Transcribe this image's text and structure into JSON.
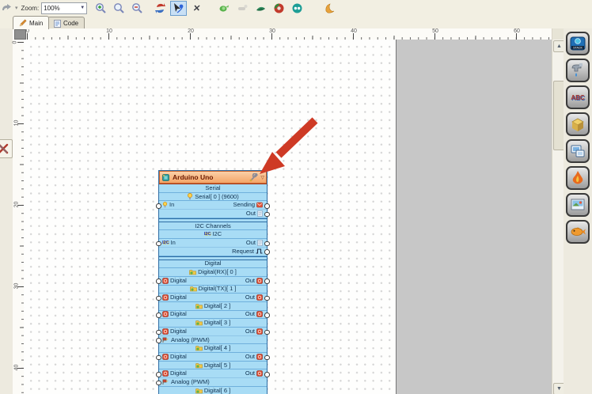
{
  "toolbar": {
    "zoom_label": "Zoom:",
    "zoom_value": "100%",
    "buttons": [
      "undo",
      "zoom-in",
      "zoom-normal",
      "zoom-out",
      "reconnect",
      "wire-mode",
      "delete",
      "component-green",
      "component-gray",
      "component-darkgreen",
      "build",
      "connect",
      "upload"
    ]
  },
  "tabs": {
    "main": "Main",
    "code": "Code"
  },
  "rulers": {
    "h": [
      "0",
      "10",
      "20",
      "30",
      "40",
      "50",
      "60"
    ],
    "v": [
      "0",
      "10",
      "20",
      "30",
      "40"
    ]
  },
  "block": {
    "title": "Arduino Uno",
    "rows": [
      {
        "t": "section",
        "label": "Serial"
      },
      {
        "t": "chan",
        "label": "Serial[ 0 ] (9600)",
        "icon": "lamp-icon"
      },
      {
        "t": "pins",
        "left": {
          "label": "In",
          "icon": "lamp-icon"
        },
        "right": {
          "label": "Sending",
          "icon": "send-icon"
        }
      },
      {
        "t": "pins",
        "right": {
          "label": "Out",
          "icon": "clipboard-icon"
        }
      },
      {
        "t": "gap"
      },
      {
        "t": "section",
        "label": "I2C Channels"
      },
      {
        "t": "chan",
        "label": "I2C",
        "icon": "i2c-icon"
      },
      {
        "t": "pins",
        "left": {
          "label": "In",
          "icon": "i2c-icon"
        },
        "right": {
          "label": "Out",
          "icon": "clipboard-icon"
        }
      },
      {
        "t": "pins",
        "right": {
          "label": "Request",
          "icon": "square-wave-icon"
        }
      },
      {
        "t": "gap"
      },
      {
        "t": "section",
        "label": "Digital"
      },
      {
        "t": "chan",
        "label": "Digital(RX)[ 0 ]",
        "icon": "folder-icon"
      },
      {
        "t": "pins",
        "left": {
          "label": "Digital",
          "icon": "digital-pin-icon"
        },
        "right": {
          "label": "Out",
          "icon": "digital-pin-icon"
        }
      },
      {
        "t": "chan",
        "label": "Digital(TX)[ 1 ]",
        "icon": "folder-icon"
      },
      {
        "t": "pins",
        "left": {
          "label": "Digital",
          "icon": "digital-pin-icon"
        },
        "right": {
          "label": "Out",
          "icon": "digital-pin-icon"
        }
      },
      {
        "t": "chan",
        "label": "Digital[ 2 ]",
        "icon": "folder-icon"
      },
      {
        "t": "pins",
        "left": {
          "label": "Digital",
          "icon": "digital-pin-icon"
        },
        "right": {
          "label": "Out",
          "icon": "digital-pin-icon"
        }
      },
      {
        "t": "chan",
        "label": "Digital[ 3 ]",
        "icon": "folder-icon"
      },
      {
        "t": "pins",
        "left": {
          "label": "Digital",
          "icon": "digital-pin-icon"
        },
        "right": {
          "label": "Out",
          "icon": "digital-pin-icon"
        }
      },
      {
        "t": "pins",
        "left": {
          "label": "Analog (PWM)",
          "icon": "analog-pwm-icon"
        }
      },
      {
        "t": "chan",
        "label": "Digital[ 4 ]",
        "icon": "folder-icon"
      },
      {
        "t": "pins",
        "left": {
          "label": "Digital",
          "icon": "digital-pin-icon"
        },
        "right": {
          "label": "Out",
          "icon": "digital-pin-icon"
        }
      },
      {
        "t": "chan",
        "label": "Digital[ 5 ]",
        "icon": "folder-icon"
      },
      {
        "t": "pins",
        "left": {
          "label": "Digital",
          "icon": "digital-pin-icon"
        },
        "right": {
          "label": "Out",
          "icon": "digital-pin-icon"
        }
      },
      {
        "t": "pins",
        "left": {
          "label": "Analog (PWM)",
          "icon": "analog-pwm-icon"
        }
      },
      {
        "t": "chan",
        "label": "Digital[ 6 ]",
        "icon": "folder-icon"
      }
    ]
  },
  "icon_glyphs": {
    "i2c": "I2C",
    "stack": "STACK",
    "abc": "ABC"
  },
  "right_panel": {
    "icons": [
      "m5stack-category",
      "water-category",
      "text-category",
      "package-category",
      "display-category",
      "fire-category",
      "image-category",
      "fish-category"
    ]
  }
}
